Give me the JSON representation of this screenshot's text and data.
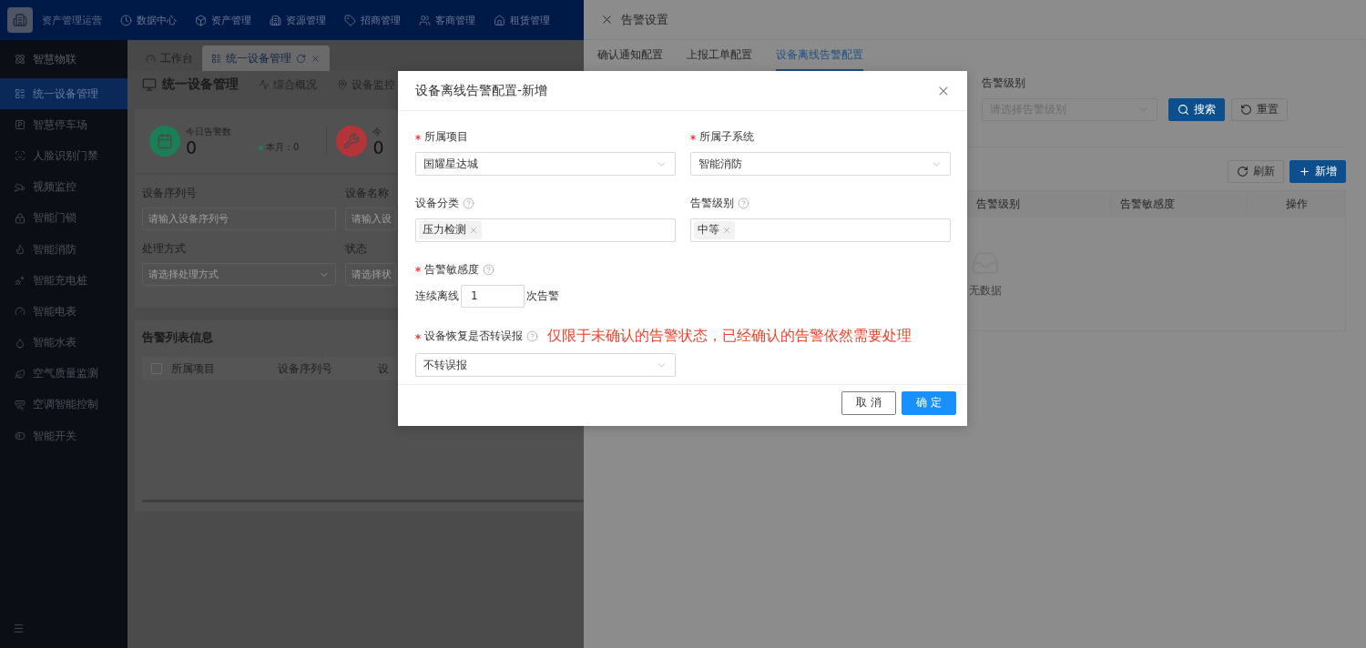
{
  "header": {
    "brand": "资产管理运营",
    "nav": [
      "数据中心",
      "资产管理",
      "资源管理",
      "招商管理",
      "客商管理",
      "租赁管理"
    ]
  },
  "sidebar": {
    "group": "智慧物联",
    "items": [
      {
        "label": "统一设备管理",
        "selected": true
      },
      {
        "label": "智慧停车场",
        "selected": false
      },
      {
        "label": "人脸识别门禁",
        "selected": false
      },
      {
        "label": "视频监控",
        "selected": false
      },
      {
        "label": "智能门锁",
        "selected": false
      },
      {
        "label": "智能消防",
        "selected": false
      },
      {
        "label": "智能充电桩",
        "selected": false
      },
      {
        "label": "智能电表",
        "selected": false
      },
      {
        "label": "智能水表",
        "selected": false
      },
      {
        "label": "空气质量监测",
        "selected": false
      },
      {
        "label": "空调智能控制",
        "selected": false
      },
      {
        "label": "智能开关",
        "selected": false
      }
    ]
  },
  "tabs": [
    {
      "label": "工作台",
      "selected": false,
      "closable": false
    },
    {
      "label": "统一设备管理",
      "selected": true,
      "closable": true
    }
  ],
  "page": {
    "title": "统一设备管理",
    "subnav": [
      "综合概况",
      "设备监控"
    ],
    "stats": [
      {
        "label": "今日告警数",
        "value": "0",
        "note": "本月：0",
        "color": "#1a7f56"
      },
      {
        "label": "今",
        "value": "0",
        "color": "#b3353a"
      }
    ],
    "filters": [
      {
        "label": "设备序列号",
        "placeholder": "请输入设备序列号",
        "kind": "input"
      },
      {
        "label": "设备名称",
        "placeholder": "请输入设",
        "kind": "input"
      },
      {
        "label": "处理方式",
        "placeholder": "请选择处理方式",
        "kind": "select"
      },
      {
        "label": "状态",
        "placeholder": "请选择状",
        "kind": "select"
      }
    ],
    "alarm_list": {
      "title": "告警列表信息",
      "checked": false,
      "columns": [
        "所属项目",
        "设备序列号",
        "设"
      ]
    }
  },
  "drawer": {
    "title": "告警设置",
    "tabs": [
      {
        "label": "确认通知配置",
        "selected": false
      },
      {
        "label": "上报工单配置",
        "selected": false
      },
      {
        "label": "设备离线告警配置",
        "selected": true
      }
    ],
    "filter": {
      "label": "告警级别",
      "placeholder": "请选择告警级别"
    },
    "filter_buttons": [
      {
        "label": "搜索",
        "kind": "primary"
      },
      {
        "label": "重置",
        "kind": "default"
      }
    ],
    "toolbar_buttons": [
      {
        "label": "刷新",
        "kind": "default"
      },
      {
        "label": "新增",
        "kind": "primary"
      }
    ],
    "columns": [
      "告警级别",
      "告警敏感度",
      "操作"
    ],
    "empty_text": "无数据"
  },
  "dialog": {
    "title": "设备离线告警配置-新增",
    "fields": [
      {
        "label": "所属项目",
        "required": true,
        "help": false,
        "kind": "select",
        "value": "国耀星达城"
      },
      {
        "label": "所属子系统",
        "required": true,
        "help": false,
        "kind": "select",
        "value": "智能消防"
      },
      {
        "label": "设备分类",
        "required": false,
        "help": true,
        "kind": "tags",
        "tags": [
          "压力检测"
        ]
      },
      {
        "label": "告警级别",
        "required": false,
        "help": true,
        "kind": "tags",
        "tags": [
          "中等"
        ]
      },
      {
        "label": "告警敏感度",
        "required": true,
        "help": true,
        "kind": "count",
        "prefix": "连续离线",
        "value": "1",
        "suffix": "次告警"
      },
      {
        "label": "设备恢复是否转误报",
        "required": true,
        "help": true,
        "kind": "select",
        "value": "不转误报",
        "note": "仅限于未确认的告警状态，已经确认的告警依然需要处理"
      }
    ],
    "buttons": [
      {
        "label": "取 消",
        "kind": "default"
      },
      {
        "label": "确 定",
        "kind": "primary"
      }
    ]
  }
}
